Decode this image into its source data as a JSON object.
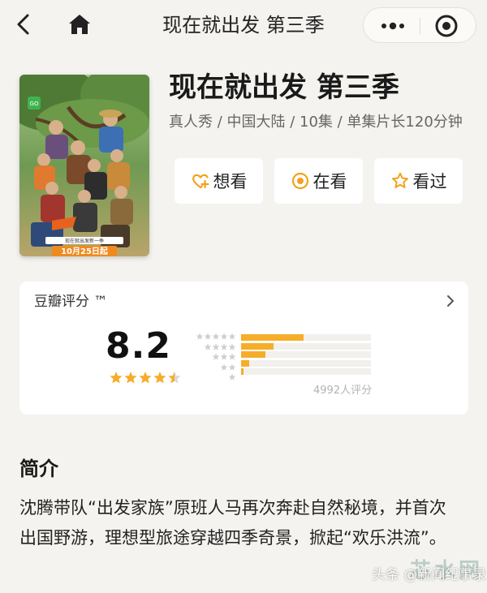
{
  "nav": {
    "title": "现在就出发 第三季"
  },
  "show": {
    "title": "现在就出发 第三季",
    "meta": "真人秀 / 中国大陆 / 10集 / 单集片长120分钟",
    "poster": {
      "badge_text": "现在就出发新一季",
      "date_text": "10月25日起"
    }
  },
  "actions": [
    {
      "label": "想看",
      "icon": "heart-plus-icon"
    },
    {
      "label": "在看",
      "icon": "target-icon"
    },
    {
      "label": "看过",
      "icon": "star-outline-icon"
    }
  ],
  "rating": {
    "label": "豆瓣评分 ™",
    "score": "8.2",
    "stars": 4.5,
    "distribution": [
      {
        "stars": 5,
        "fraction": 0.48
      },
      {
        "stars": 4,
        "fraction": 0.25
      },
      {
        "stars": 3,
        "fraction": 0.19
      },
      {
        "stars": 2,
        "fraction": 0.06
      },
      {
        "stars": 1,
        "fraction": 0.02
      }
    ],
    "votes": "4992人评分"
  },
  "intro": {
    "heading": "简介",
    "text": "沈腾带队“出发家族”原班人马再次奔赴自然秘境，并首次出国野游，理想型旅途穿越四季奇景，掀起“欢乐洪流”。"
  },
  "watermark": {
    "text": "头条 @新闻纪事录",
    "logo": "芯水网"
  },
  "colors": {
    "accent": "#f5ad2a",
    "background": "#f4f3ef"
  }
}
